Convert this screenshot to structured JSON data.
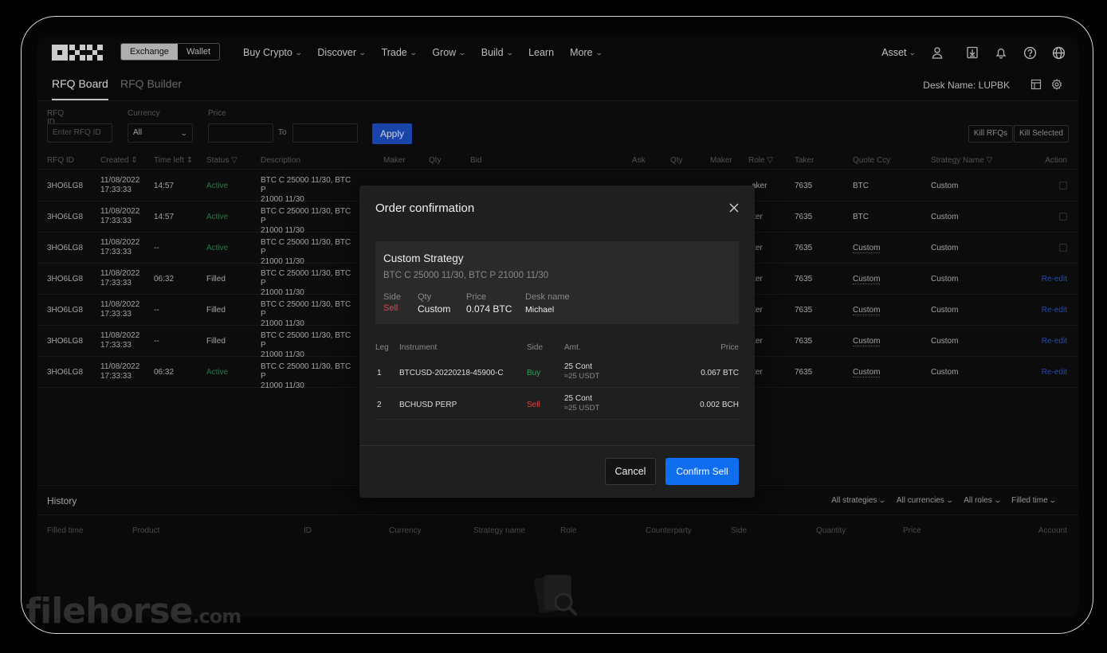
{
  "nav": {
    "segment": [
      "Exchange",
      "Wallet"
    ],
    "menu": [
      "Buy Crypto",
      "Discover",
      "Trade",
      "Grow",
      "Build",
      "Learn",
      "More"
    ],
    "asset": "Asset"
  },
  "subnav": {
    "tabs": [
      "RFQ Board",
      "RFQ Builder"
    ],
    "desk_name": "Desk Name: LUPBK"
  },
  "filters": {
    "rfq_id_label": "RFQ ID",
    "rfq_id_placeholder": "Enter RFQ ID",
    "currency_label": "Currency",
    "currency_value": "All",
    "price_label": "Price",
    "to_label": "To",
    "apply": "Apply",
    "kill_rfqs": "Kill RFQs",
    "kill_selected": "Kill Selected"
  },
  "table": {
    "headers": {
      "rfq_id": "RFQ ID",
      "created": "Created ⇕",
      "time_left": "Time left ⇕",
      "status": "Status ▽",
      "description": "Description",
      "maker": "Maker",
      "qty": "Qty",
      "bid": "Bid",
      "ask": "Ask",
      "qty2": "Qty",
      "maker2": "Maker",
      "role": "Role ▽",
      "taker": "Taker",
      "quote_ccy": "Quote Ccy",
      "strategy_name": "Strategy Name ▽",
      "action": "Action"
    },
    "rows": [
      {
        "id": "3HO6LG8",
        "date": "11/08/2022",
        "time": "17:33:33",
        "left": "14:57",
        "status": "Active",
        "desc1": "BTC C 25000 11/30, BTC P",
        "desc2": "21000 11/30",
        "role": "aker",
        "taker": "7635",
        "qccy": "BTC",
        "strat": "Custom",
        "action": ""
      },
      {
        "id": "3HO6LG8",
        "date": "11/08/2022",
        "time": "17:33:33",
        "left": "14:57",
        "status": "Active",
        "desc1": "BTC C 25000 11/30, BTC P",
        "desc2": "21000 11/30",
        "role": "ker",
        "taker": "7635",
        "qccy": "BTC",
        "strat": "Custom",
        "action": ""
      },
      {
        "id": "3HO6LG8",
        "date": "11/08/2022",
        "time": "17:33:33",
        "left": "--",
        "status": "Active",
        "desc1": "BTC C 25000 11/30, BTC P",
        "desc2": "21000 11/30",
        "role": "ker",
        "taker": "7635",
        "qccy": "Custom",
        "strat": "Custom",
        "action": ""
      },
      {
        "id": "3HO6LG8",
        "date": "11/08/2022",
        "time": "17:33:33",
        "left": "06:32",
        "status": "Filled",
        "desc1": "BTC C 25000 11/30, BTC P",
        "desc2": "21000 11/30",
        "role": "ker",
        "taker": "7635",
        "qccy": "Custom",
        "strat": "Custom",
        "action": "Re-edit"
      },
      {
        "id": "3HO6LG8",
        "date": "11/08/2022",
        "time": "17:33:33",
        "left": "--",
        "status": "Filled",
        "desc1": "BTC C 25000 11/30, BTC P",
        "desc2": "21000 11/30",
        "role": "ker",
        "taker": "7635",
        "qccy": "Custom",
        "strat": "Custom",
        "action": "Re-edit"
      },
      {
        "id": "3HO6LG8",
        "date": "11/08/2022",
        "time": "17:33:33",
        "left": "--",
        "status": "Filled",
        "desc1": "BTC C 25000 11/30, BTC P",
        "desc2": "21000 11/30",
        "role": "ker",
        "taker": "7635",
        "qccy": "Custom",
        "strat": "Custom",
        "action": "Re-edit"
      },
      {
        "id": "3HO6LG8",
        "date": "11/08/2022",
        "time": "17:33:33",
        "left": "06:32",
        "status": "Active",
        "desc1": "BTC C 25000 11/30, BTC P",
        "desc2": "21000 11/30",
        "role": "ker",
        "taker": "7635",
        "qccy": "Custom",
        "strat": "Custom",
        "action": "Re-edit"
      }
    ]
  },
  "history": {
    "title": "History",
    "filters": [
      "All strategies",
      "All currencies",
      "All roles",
      "Filled time"
    ],
    "headers": [
      "Filled time",
      "Product",
      "ID",
      "Currency",
      "Strategy name",
      "Role",
      "Counterparty",
      "Side",
      "Quantity",
      "Price",
      "Account"
    ]
  },
  "modal": {
    "title": "Order confirmation",
    "strategy_name": "Custom Strategy",
    "strategy_desc": "BTC C 25000 11/30, BTC P 21000 11/30",
    "side_label": "Side",
    "side_value": "Sell",
    "qty_label": "Qty",
    "qty_value": "Custom",
    "price_label": "Price",
    "price_value": "0.074 BTC",
    "desk_label": "Desk name",
    "desk_value": "Michael",
    "leg_headers": {
      "leg": "Leg",
      "instrument": "Instrument",
      "side": "Side",
      "amt": "Amt.",
      "price": "Price"
    },
    "legs": [
      {
        "leg": "1",
        "instrument": "BTCUSD-20220218-45900-C",
        "side": "Buy",
        "amt": "25 Cont",
        "amt_usdt": "≈25 USDT",
        "price": "0.067 BTC"
      },
      {
        "leg": "2",
        "instrument": "BCHUSD PERP",
        "side": "Sell",
        "amt": "25 Cont",
        "amt_usdt": "≈25 USDT",
        "price": "0.002 BCH"
      }
    ],
    "cancel": "Cancel",
    "confirm": "Confirm Sell"
  },
  "watermark": {
    "main": "filehorse",
    "suffix": ".com"
  },
  "colors": {
    "accent": "#0f6df0",
    "sell": "#d94848",
    "buy": "#2f9c5b",
    "active": "#2a8a55",
    "link": "#2b55c8"
  }
}
